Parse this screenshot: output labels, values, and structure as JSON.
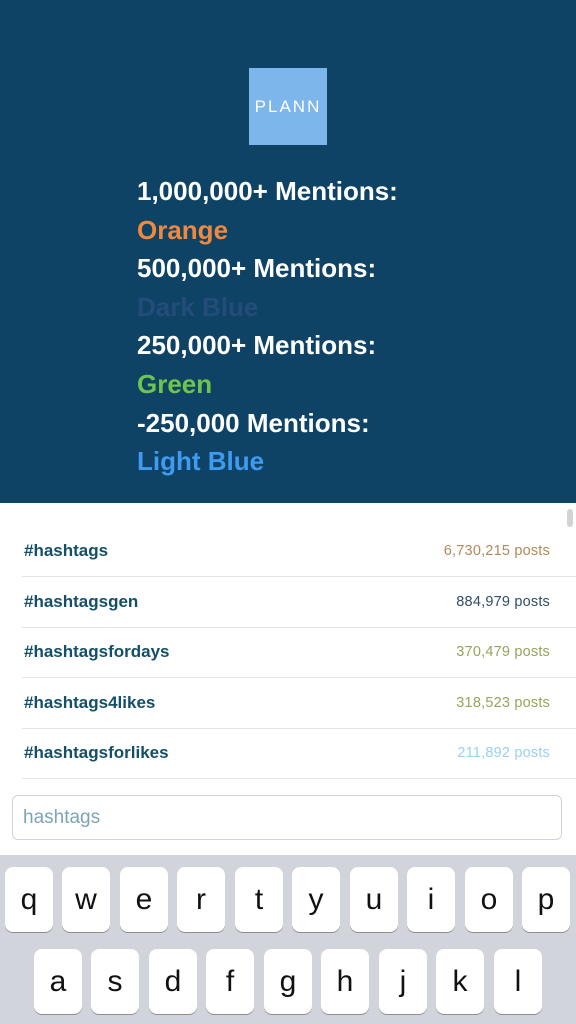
{
  "logo": {
    "text": "PLANN"
  },
  "legend": [
    {
      "label": "1,000,000+ Mentions:",
      "color_name": "Orange",
      "color": "#f0883e"
    },
    {
      "label": "500,000+ Mentions:",
      "color_name": "Dark Blue",
      "color": "#234c78"
    },
    {
      "label": "250,000+ Mentions:",
      "color_name": "Green",
      "color": "#6dc54e"
    },
    {
      "label": "-250,000 Mentions:",
      "color_name": "Light Blue",
      "color": "#3f9bf0"
    }
  ],
  "hashtags": [
    {
      "tag": "#hashtags",
      "count": "6,730,215 posts",
      "color": "#b08a5a"
    },
    {
      "tag": "#hashtagsgen",
      "count": "884,979 posts",
      "color": "#2f4d66"
    },
    {
      "tag": "#hashtagsfordays",
      "count": "370,479 posts",
      "color": "#97a45a"
    },
    {
      "tag": "#hashtags4likes",
      "count": "318,523 posts",
      "color": "#97a45a"
    },
    {
      "tag": "#hashtagsforlikes",
      "count": "211,892 posts",
      "color": "#9ad0ee"
    }
  ],
  "search": {
    "value": "hashtags"
  },
  "keyboard": {
    "row1": [
      "q",
      "w",
      "e",
      "r",
      "t",
      "y",
      "u",
      "i",
      "o",
      "p"
    ],
    "row2": [
      "a",
      "s",
      "d",
      "f",
      "g",
      "h",
      "j",
      "k",
      "l"
    ]
  }
}
